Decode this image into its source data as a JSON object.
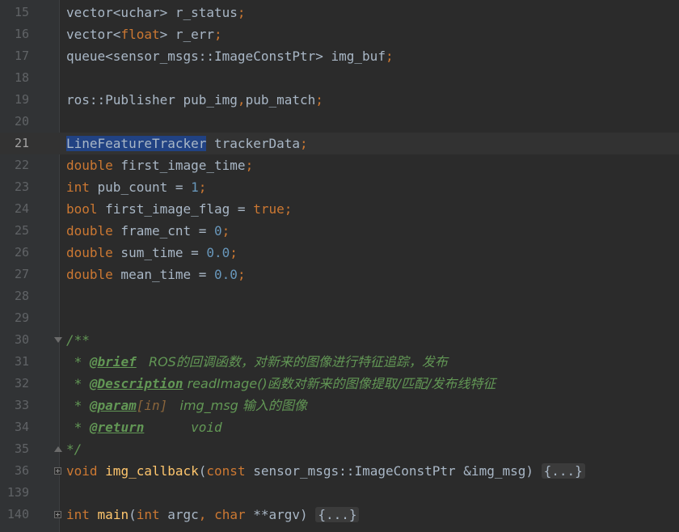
{
  "editor": {
    "lines": [
      {
        "num": "15",
        "parts": [
          [
            "plain",
            "vector<uchar> r_status"
          ],
          [
            "punct",
            ";"
          ]
        ]
      },
      {
        "num": "16",
        "parts": [
          [
            "plain",
            "vector<"
          ],
          [
            "kw",
            "float"
          ],
          [
            "plain",
            "> r_err"
          ],
          [
            "punct",
            ";"
          ]
        ]
      },
      {
        "num": "17",
        "parts": [
          [
            "plain",
            "queue<sensor_msgs::ImageConstPtr> img_buf"
          ],
          [
            "punct",
            ";"
          ]
        ]
      },
      {
        "num": "18",
        "parts": []
      },
      {
        "num": "19",
        "parts": [
          [
            "plain",
            "ros::Publisher pub_img"
          ],
          [
            "punct",
            ","
          ],
          [
            "plain",
            "pub_match"
          ],
          [
            "punct",
            ";"
          ]
        ]
      },
      {
        "num": "20",
        "parts": []
      },
      {
        "num": "21",
        "current": true,
        "parts": [
          [
            "sel",
            "LineFeatureTracker"
          ],
          [
            "plain",
            " trackerData"
          ],
          [
            "punct",
            ";"
          ]
        ]
      },
      {
        "num": "22",
        "parts": [
          [
            "kw",
            "double"
          ],
          [
            "plain",
            " first_image_time"
          ],
          [
            "punct",
            ";"
          ]
        ]
      },
      {
        "num": "23",
        "parts": [
          [
            "kw",
            "int"
          ],
          [
            "plain",
            " pub_count = "
          ],
          [
            "num",
            "1"
          ],
          [
            "punct",
            ";"
          ]
        ]
      },
      {
        "num": "24",
        "parts": [
          [
            "kw",
            "bool"
          ],
          [
            "plain",
            " first_image_flag = "
          ],
          [
            "kw",
            "true"
          ],
          [
            "punct",
            ";"
          ]
        ]
      },
      {
        "num": "25",
        "parts": [
          [
            "kw",
            "double"
          ],
          [
            "plain",
            " frame_cnt = "
          ],
          [
            "num",
            "0"
          ],
          [
            "punct",
            ";"
          ]
        ]
      },
      {
        "num": "26",
        "parts": [
          [
            "kw",
            "double"
          ],
          [
            "plain",
            " sum_time = "
          ],
          [
            "num",
            "0.0"
          ],
          [
            "punct",
            ";"
          ]
        ]
      },
      {
        "num": "27",
        "parts": [
          [
            "kw",
            "double"
          ],
          [
            "plain",
            " mean_time = "
          ],
          [
            "num",
            "0.0"
          ],
          [
            "punct",
            ";"
          ]
        ]
      },
      {
        "num": "28",
        "parts": []
      },
      {
        "num": "29",
        "parts": []
      },
      {
        "num": "30",
        "fold": "open",
        "parts": [
          [
            "doc",
            "/**"
          ]
        ]
      },
      {
        "num": "31",
        "parts": [
          [
            "doc",
            " * "
          ],
          [
            "doctag",
            "@brief"
          ],
          [
            "doc",
            "   ROS的回调函数，对新来的图像进行特征追踪，发布"
          ]
        ]
      },
      {
        "num": "32",
        "parts": [
          [
            "doc",
            " * "
          ],
          [
            "doctag",
            "@Description"
          ],
          [
            "doc",
            " readImage()函数对新来的图像提取/匹配/发布线特征"
          ]
        ]
      },
      {
        "num": "33",
        "parts": [
          [
            "doc",
            " * "
          ],
          [
            "doctag",
            "@param"
          ],
          [
            "docparam",
            "[in]"
          ],
          [
            "doc",
            "   img_msg 输入的图像"
          ]
        ]
      },
      {
        "num": "34",
        "parts": [
          [
            "doc",
            " * "
          ],
          [
            "doctag",
            "@return"
          ],
          [
            "doc",
            "      void"
          ]
        ]
      },
      {
        "num": "35",
        "fold": "close",
        "parts": [
          [
            "doc",
            "*/"
          ]
        ]
      },
      {
        "num": "36",
        "fold": "plus",
        "parts": [
          [
            "kw",
            "void"
          ],
          [
            "plain",
            " "
          ],
          [
            "fn",
            "img_callback"
          ],
          [
            "plain",
            "("
          ],
          [
            "kw",
            "const"
          ],
          [
            "plain",
            " sensor_msgs::ImageConstPtr &img_msg) "
          ],
          [
            "collapsed",
            "{...}"
          ]
        ]
      },
      {
        "num": "139",
        "parts": []
      },
      {
        "num": "140",
        "fold": "plus",
        "parts": [
          [
            "kw",
            "int"
          ],
          [
            "plain",
            " "
          ],
          [
            "fn",
            "main"
          ],
          [
            "plain",
            "("
          ],
          [
            "kw",
            "int"
          ],
          [
            "plain",
            " argc"
          ],
          [
            "punct",
            ","
          ],
          [
            "plain",
            " "
          ],
          [
            "kw",
            "char"
          ],
          [
            "plain",
            " **argv) "
          ],
          [
            "collapsed",
            "{...}"
          ]
        ]
      }
    ]
  },
  "colors": {
    "background": "#2b2b2b",
    "keyword": "#cc7832",
    "number": "#6897bb",
    "function": "#ffc66d",
    "doc_comment": "#629755",
    "selection": "#214283"
  }
}
